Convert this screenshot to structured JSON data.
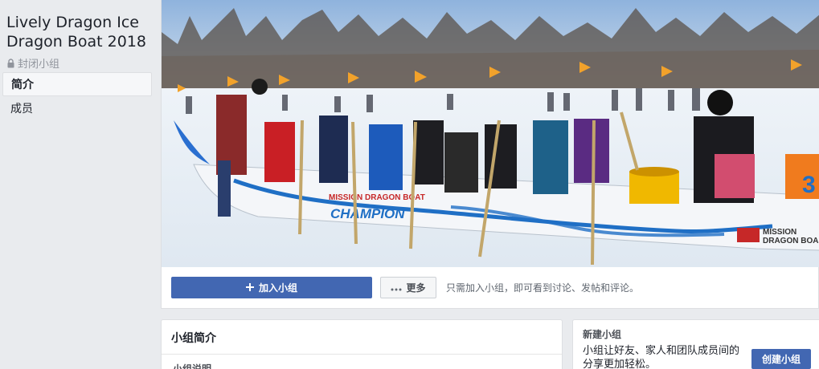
{
  "sidebar": {
    "group_name": "Lively Dragon Ice Dragon Boat 2018",
    "privacy_label": "封闭小组",
    "nav": [
      {
        "label": "简介",
        "active": true
      },
      {
        "label": "成员",
        "active": false
      }
    ]
  },
  "cover": {
    "boat_text_1": "MISSION DRAGON BOAT",
    "boat_text_2": "CHAMPION",
    "boat_text_3": "MISSION",
    "boat_text_4": "DRAGON BOA",
    "boat_number": "3"
  },
  "actions": {
    "join_label": "加入小组",
    "more_label": "更多",
    "join_hint": "只需加入小组，即可看到讨论、发帖和评论。"
  },
  "about": {
    "title": "小组简介",
    "subtitle": "小组说明"
  },
  "create_group": {
    "title": "新建小组",
    "description": "小组让好友、家人和团队成员间的分享更加轻松。",
    "button_label": "创建小组"
  },
  "colors": {
    "brand_blue": "#4267b2",
    "page_bg": "#e9ebee",
    "boat_blue": "#1f6fc5"
  }
}
